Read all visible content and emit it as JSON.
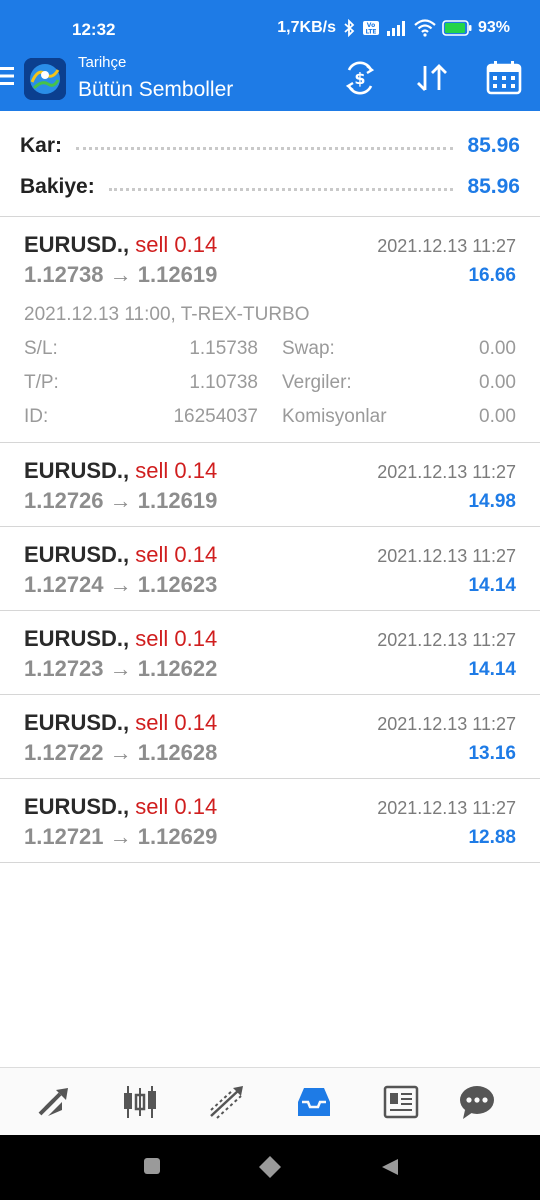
{
  "status_bar": {
    "time": "12:32",
    "net_speed": "1,7KB/s",
    "volte": "Vo LTE",
    "battery": "93%"
  },
  "toolbar": {
    "subtitle": "Tarihçe",
    "title": "Bütün Semboller",
    "icons": [
      "menu-icon",
      "app-logo",
      "currency-exchange-icon",
      "sort-icon",
      "calendar-icon"
    ]
  },
  "summary": {
    "profit_label": "Kar:",
    "profit_value": "85.96",
    "balance_label": "Bakiye:",
    "balance_value": "85.96"
  },
  "trades": [
    {
      "symbol": "EURUSD.,",
      "side": "sell 0.14",
      "open_price": "1.12738",
      "arrow": "→",
      "close_price": "1.12619",
      "time": "2021.12.13 11:27",
      "profit": "16.66",
      "open_info": "2021.12.13 11:00, T-REX-TURBO",
      "details": {
        "sl_label": "S/L:",
        "sl_value": "1.15738",
        "swap_label": "Swap:",
        "swap_value": "0.00",
        "tp_label": "T/P:",
        "tp_value": "1.10738",
        "tax_label": "Vergiler:",
        "tax_value": "0.00",
        "id_label": "ID:",
        "id_value": "16254037",
        "commission_label": "Komisyonlar",
        "commission_value": "0.00"
      }
    },
    {
      "symbol": "EURUSD.,",
      "side": "sell 0.14",
      "open_price": "1.12726",
      "arrow": "→",
      "close_price": "1.12619",
      "time": "2021.12.13 11:27",
      "profit": "14.98"
    },
    {
      "symbol": "EURUSD.,",
      "side": "sell 0.14",
      "open_price": "1.12724",
      "arrow": "→",
      "close_price": "1.12623",
      "time": "2021.12.13 11:27",
      "profit": "14.14"
    },
    {
      "symbol": "EURUSD.,",
      "side": "sell 0.14",
      "open_price": "1.12723",
      "arrow": "→",
      "close_price": "1.12622",
      "time": "2021.12.13 11:27",
      "profit": "14.14"
    },
    {
      "symbol": "EURUSD.,",
      "side": "sell 0.14",
      "open_price": "1.12722",
      "arrow": "→",
      "close_price": "1.12628",
      "time": "2021.12.13 11:27",
      "profit": "13.16"
    },
    {
      "symbol": "EURUSD.,",
      "side": "sell 0.14",
      "open_price": "1.12721",
      "arrow": "→",
      "close_price": "1.12629",
      "time": "2021.12.13 11:27",
      "profit": "12.88"
    }
  ],
  "bottom_nav": {
    "items": [
      "quotes-icon",
      "chart-icon",
      "trade-icon",
      "history-icon",
      "news-icon",
      "chat-icon"
    ],
    "active": "history-icon",
    "accent": "#1e7be6",
    "inactive_color": "#555555"
  },
  "colors": {
    "header": "#1e7be6",
    "sell": "#d01e1e",
    "profit": "#1e7be6"
  }
}
